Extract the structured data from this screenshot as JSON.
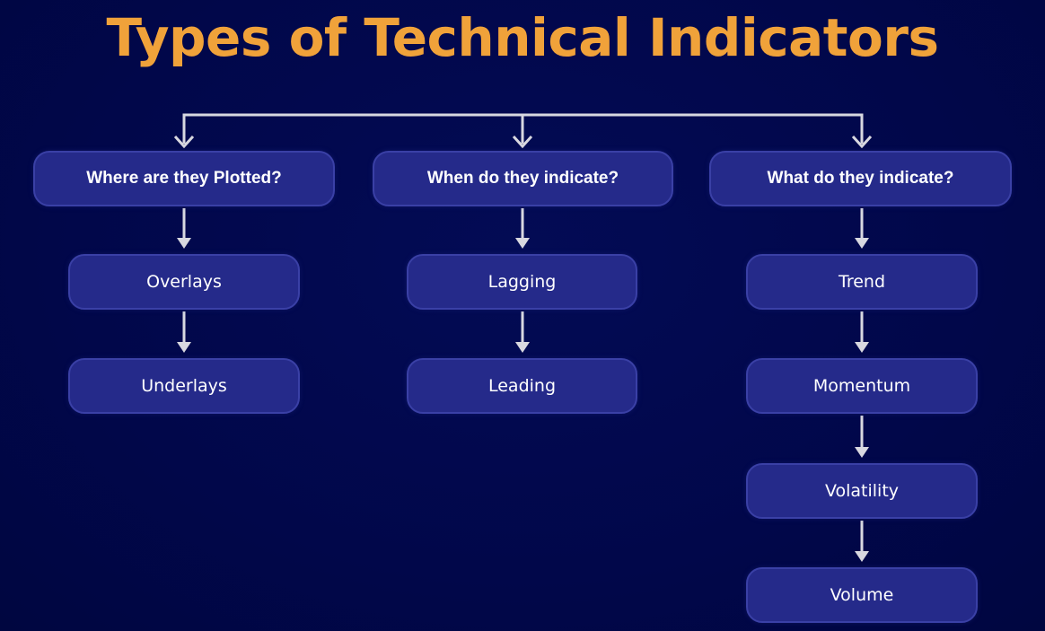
{
  "title": "Types of Technical Indicators",
  "colors": {
    "background": "#01074a",
    "title": "#f0a23a",
    "box_fill": "#252a8a",
    "box_border": "#3a40a6",
    "text": "#ffffff",
    "connector": "#d8d8e0"
  },
  "columns": [
    {
      "header": "Where are they Plotted?",
      "items": [
        "Overlays",
        "Underlays"
      ]
    },
    {
      "header": "When do they indicate?",
      "items": [
        "Lagging",
        "Leading"
      ]
    },
    {
      "header": "What do they indicate?",
      "items": [
        "Trend",
        "Momentum",
        "Volatility",
        "Volume"
      ]
    }
  ]
}
